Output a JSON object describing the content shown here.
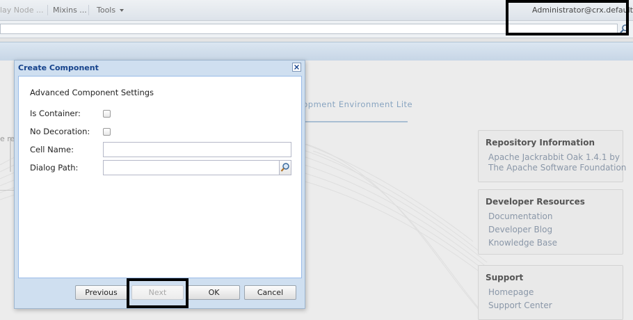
{
  "toolbar": {
    "overlay_node": "lay Node ...",
    "mixins": "Mixins ...",
    "tools": "Tools",
    "user": "Administrator@crx.default"
  },
  "background": {
    "environment_text": "elopment Environment Lite",
    "cut_text": "e rep"
  },
  "panels": {
    "repository": {
      "title": "Repository Information",
      "lines": [
        "Apache Jackrabbit Oak 1.4.1 by",
        "The Apache Software Foundation"
      ]
    },
    "developer": {
      "title": "Developer Resources",
      "lines": [
        "Documentation",
        "Developer Blog",
        "Knowledge Base"
      ]
    },
    "support": {
      "title": "Support",
      "lines": [
        "Homepage",
        "Support Center"
      ]
    }
  },
  "dialog": {
    "title": "Create Component",
    "section_title": "Advanced Component Settings",
    "fields": {
      "is_container": "Is Container:",
      "no_decoration": "No Decoration:",
      "cell_name": "Cell Name:",
      "dialog_path": "Dialog Path:"
    },
    "values": {
      "cell_name": "",
      "dialog_path": ""
    },
    "buttons": {
      "previous": "Previous",
      "next": "Next",
      "ok": "OK",
      "cancel": "Cancel"
    }
  },
  "colors": {
    "dialog_title": "#15428b",
    "dialog_frame": "#cfdff0",
    "highlight": "#000000"
  },
  "icons": [
    "search-icon",
    "close-icon",
    "chevron-down-icon",
    "magnifier-icon"
  ]
}
